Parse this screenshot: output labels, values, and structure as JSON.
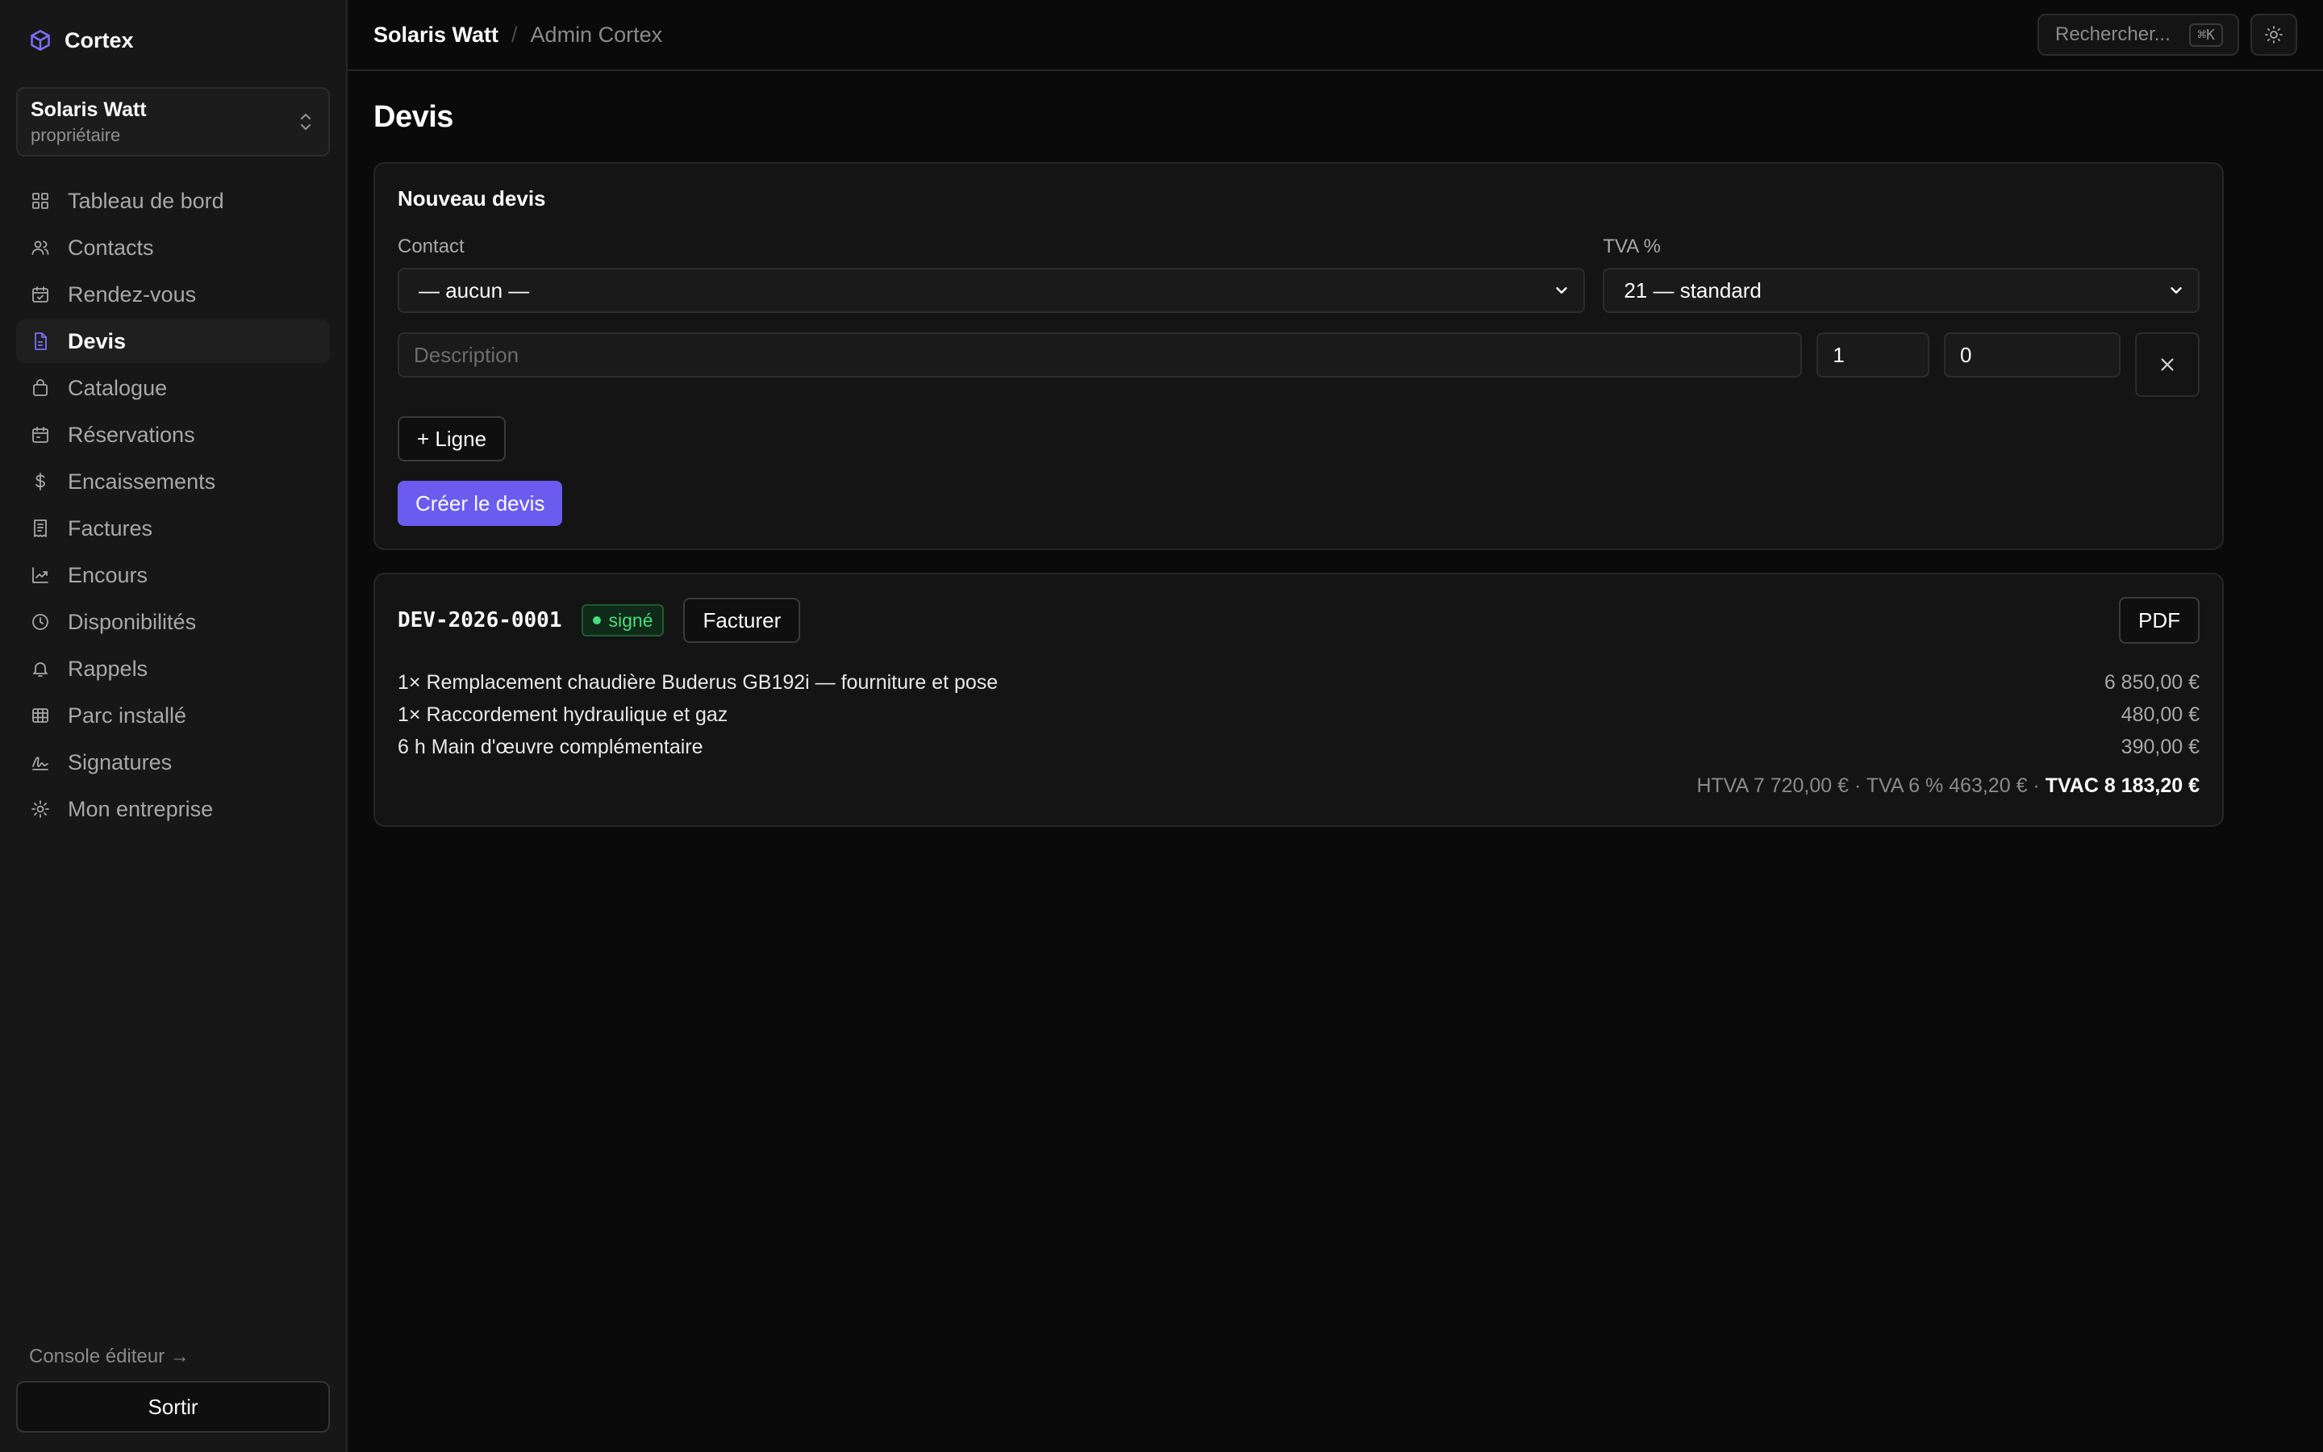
{
  "brand": {
    "name": "Cortex"
  },
  "org": {
    "name": "Solaris Watt",
    "role": "propriétaire"
  },
  "nav": {
    "items": [
      {
        "label": "Tableau de bord",
        "icon": "dashboard-icon"
      },
      {
        "label": "Contacts",
        "icon": "users-icon"
      },
      {
        "label": "Rendez-vous",
        "icon": "calendar-icon"
      },
      {
        "label": "Devis",
        "icon": "file-icon",
        "active": true
      },
      {
        "label": "Catalogue",
        "icon": "bag-icon"
      },
      {
        "label": "Réservations",
        "icon": "calendar-icon"
      },
      {
        "label": "Encaissements",
        "icon": "dollar-icon"
      },
      {
        "label": "Factures",
        "icon": "receipt-icon"
      },
      {
        "label": "Encours",
        "icon": "chart-icon"
      },
      {
        "label": "Disponibilités",
        "icon": "clock-icon"
      },
      {
        "label": "Rappels",
        "icon": "bell-icon"
      },
      {
        "label": "Parc installé",
        "icon": "table-icon"
      },
      {
        "label": "Signatures",
        "icon": "signature-icon"
      },
      {
        "label": "Mon entreprise",
        "icon": "gear-icon"
      }
    ]
  },
  "sidebar_footer": {
    "console_link": "Console éditeur →",
    "logout": "Sortir"
  },
  "topbar": {
    "crumb_org": "Solaris Watt",
    "crumb_sep": "/",
    "crumb_page": "Admin Cortex",
    "search_label": "Rechercher...",
    "search_shortcut": "⌘K"
  },
  "page": {
    "title": "Devis"
  },
  "new_quote": {
    "title": "Nouveau devis",
    "contact_label": "Contact",
    "contact_value": "— aucun —",
    "vat_label": "TVA %",
    "vat_value": "21 — standard",
    "line": {
      "description_placeholder": "Description",
      "quantity": "1",
      "price": "0"
    },
    "add_line": "+ Ligne",
    "submit": "Créer le devis"
  },
  "quote": {
    "number": "DEV-2026-0001",
    "status": "signé",
    "status_color": "#4ade80",
    "invoice_button": "Facturer",
    "pdf_button": "PDF",
    "lines": [
      {
        "description": "1× Remplacement chaudière Buderus GB192i — fourniture et pose",
        "amount": "6 850,00 €"
      },
      {
        "description": "1× Raccordement hydraulique et gaz",
        "amount": "480,00 €"
      },
      {
        "description": "6 h Main d'œuvre complémentaire",
        "amount": "390,00 €"
      }
    ],
    "totals": {
      "htva": "HTVA 7 720,00 €",
      "sep": " · ",
      "tva": "TVA 6 % 463,20 €",
      "tvac": "TVAC 8 183,20 €"
    }
  },
  "colors": {
    "accent": "#6b5cf0",
    "background": "#0a0a0a",
    "sidebar": "#171717"
  }
}
